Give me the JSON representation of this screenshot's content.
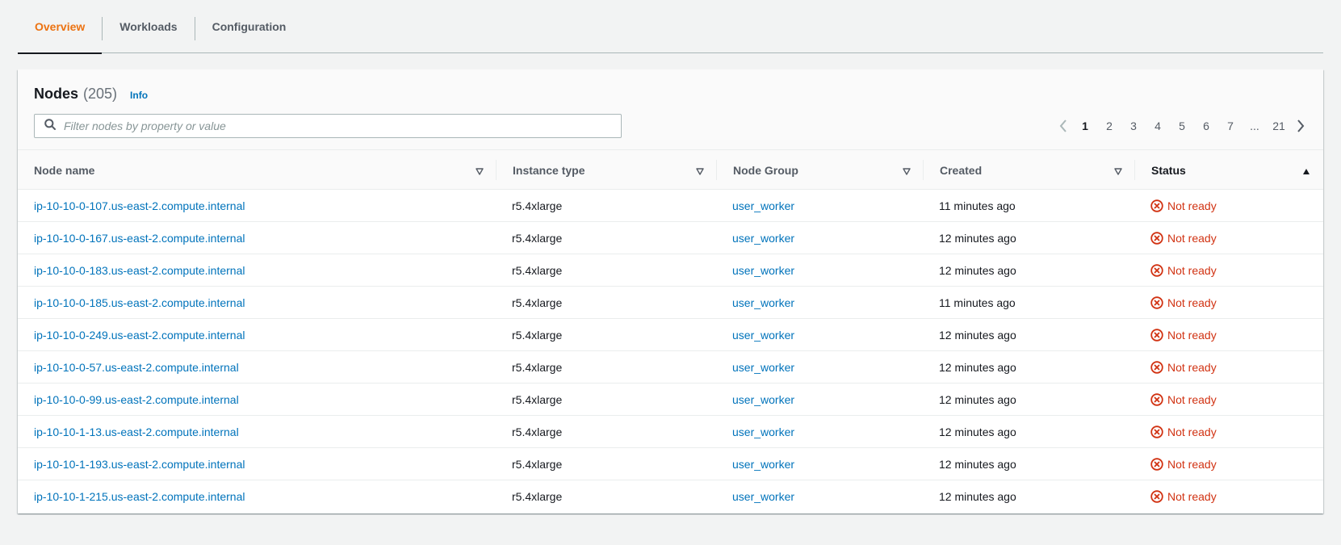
{
  "tabs": [
    {
      "label": "Overview",
      "active": true
    },
    {
      "label": "Workloads",
      "active": false
    },
    {
      "label": "Configuration",
      "active": false
    }
  ],
  "nodes": {
    "title": "Nodes",
    "count": "(205)",
    "info_link": "Info",
    "filter_placeholder": "Filter nodes by property or value",
    "filter_value": ""
  },
  "pagination": {
    "prev_icon": "chevron-left-icon",
    "next_icon": "chevron-right-icon",
    "pages": [
      "1",
      "2",
      "3",
      "4",
      "5",
      "6",
      "7",
      "...",
      "21"
    ],
    "current_page": "1"
  },
  "table": {
    "columns": [
      {
        "label": "Node name",
        "sort_icon": "sort-caret-down-outline-icon"
      },
      {
        "label": "Instance type",
        "sort_icon": "sort-caret-down-outline-icon"
      },
      {
        "label": "Node Group",
        "sort_icon": "sort-caret-down-outline-icon"
      },
      {
        "label": "Created",
        "sort_icon": "sort-caret-down-outline-icon"
      },
      {
        "label": "Status",
        "sort_icon": "sort-caret-up-filled-icon"
      }
    ],
    "rows": [
      {
        "node_name": "ip-10-10-0-107.us-east-2.compute.internal",
        "instance_type": "r5.4xlarge",
        "node_group": "user_worker",
        "created": "11 minutes ago",
        "status": "Not ready"
      },
      {
        "node_name": "ip-10-10-0-167.us-east-2.compute.internal",
        "instance_type": "r5.4xlarge",
        "node_group": "user_worker",
        "created": "12 minutes ago",
        "status": "Not ready"
      },
      {
        "node_name": "ip-10-10-0-183.us-east-2.compute.internal",
        "instance_type": "r5.4xlarge",
        "node_group": "user_worker",
        "created": "12 minutes ago",
        "status": "Not ready"
      },
      {
        "node_name": "ip-10-10-0-185.us-east-2.compute.internal",
        "instance_type": "r5.4xlarge",
        "node_group": "user_worker",
        "created": "11 minutes ago",
        "status": "Not ready"
      },
      {
        "node_name": "ip-10-10-0-249.us-east-2.compute.internal",
        "instance_type": "r5.4xlarge",
        "node_group": "user_worker",
        "created": "12 minutes ago",
        "status": "Not ready"
      },
      {
        "node_name": "ip-10-10-0-57.us-east-2.compute.internal",
        "instance_type": "r5.4xlarge",
        "node_group": "user_worker",
        "created": "12 minutes ago",
        "status": "Not ready"
      },
      {
        "node_name": "ip-10-10-0-99.us-east-2.compute.internal",
        "instance_type": "r5.4xlarge",
        "node_group": "user_worker",
        "created": "12 minutes ago",
        "status": "Not ready"
      },
      {
        "node_name": "ip-10-10-1-13.us-east-2.compute.internal",
        "instance_type": "r5.4xlarge",
        "node_group": "user_worker",
        "created": "12 minutes ago",
        "status": "Not ready"
      },
      {
        "node_name": "ip-10-10-1-193.us-east-2.compute.internal",
        "instance_type": "r5.4xlarge",
        "node_group": "user_worker",
        "created": "12 minutes ago",
        "status": "Not ready"
      },
      {
        "node_name": "ip-10-10-1-215.us-east-2.compute.internal",
        "instance_type": "r5.4xlarge",
        "node_group": "user_worker",
        "created": "12 minutes ago",
        "status": "Not ready"
      }
    ]
  },
  "colors": {
    "tab_active": "#ec7211",
    "link": "#0073bb",
    "status_error": "#d13212",
    "status_icon": "status-negative-icon"
  }
}
